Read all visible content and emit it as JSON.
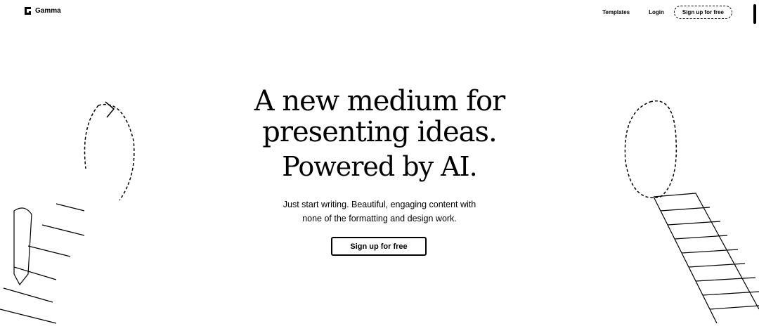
{
  "header": {
    "brand": "Gamma",
    "nav": {
      "templates": "Templates",
      "login": "Login",
      "signup": "Sign up for free"
    }
  },
  "hero": {
    "line1": "A new medium for",
    "line2": "presenting ideas.",
    "line3": "Powered by AI.",
    "subtitle_line1": "Just start writing. Beautiful, engaging content with",
    "subtitle_line2": "none of the formatting and design work.",
    "cta": "Sign up for free"
  }
}
